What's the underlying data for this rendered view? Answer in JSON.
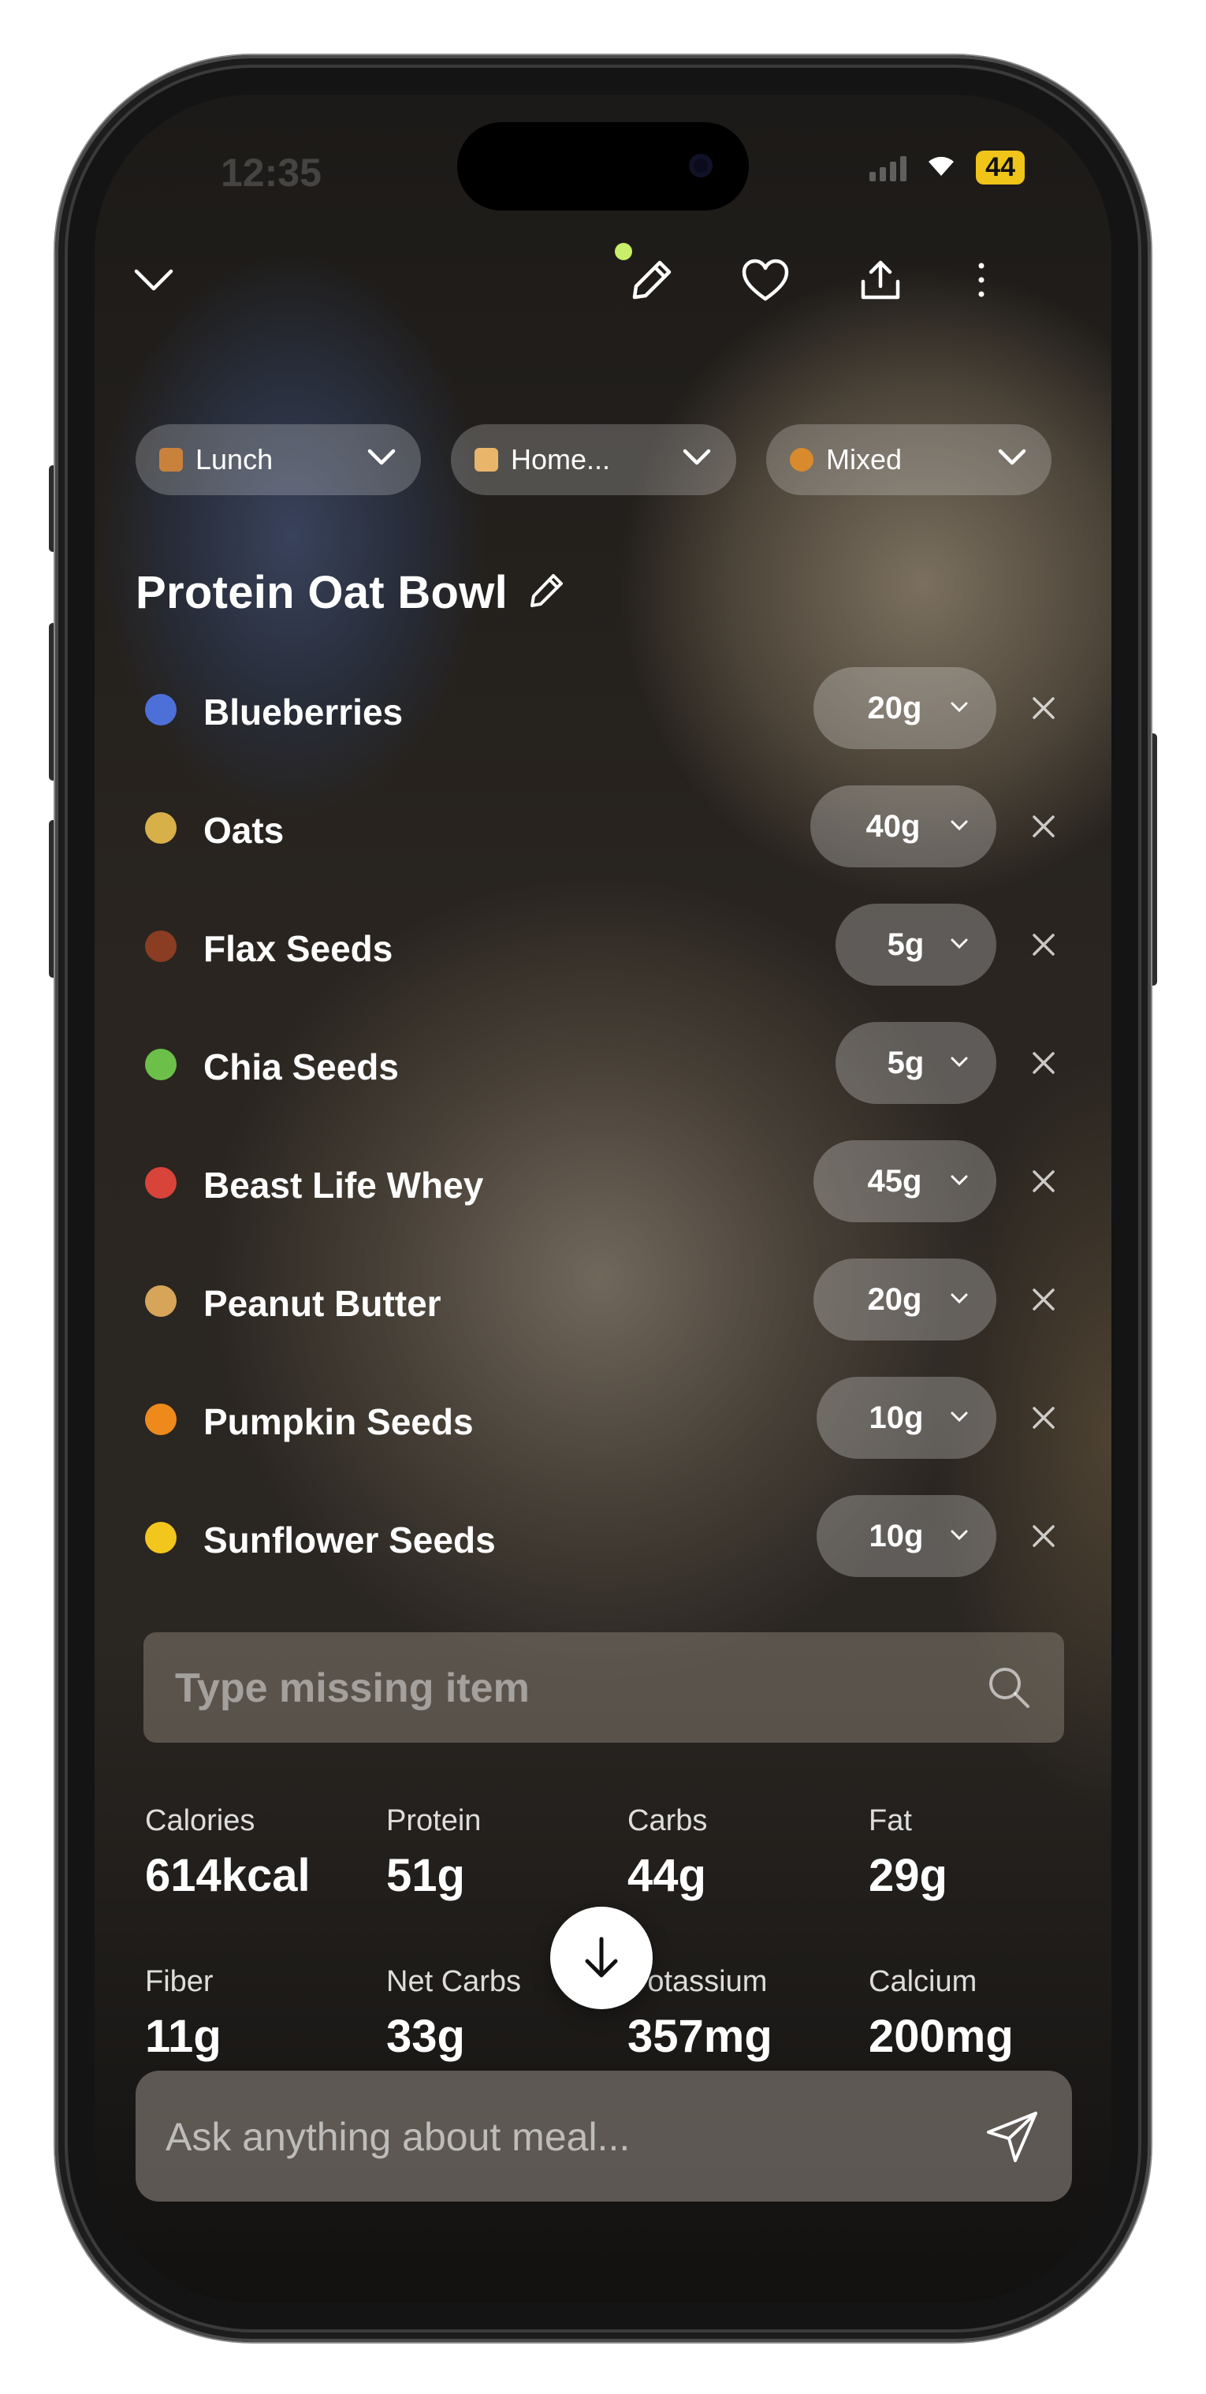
{
  "status_bar": {
    "time": "12:35",
    "battery": "44"
  },
  "toolbar": {
    "collapse_icon": "chevron-down-icon",
    "edit_icon": "pencil-icon",
    "favorite_icon": "heart-icon",
    "share_icon": "share-icon",
    "more_icon": "more-vertical-icon"
  },
  "chips": [
    {
      "label": "Lunch",
      "icon": "bento-emoji",
      "color": "#c9823c"
    },
    {
      "label": "Home...",
      "icon": "house-emoji",
      "color": "#e8b56b"
    },
    {
      "label": "Mixed",
      "icon": "mixed-emoji",
      "color": "#d88a2c"
    }
  ],
  "meal": {
    "title": "Protein Oat Bowl"
  },
  "ingredients": [
    {
      "name": "Blueberries",
      "qty": "20g",
      "icon": "blueberries-emoji",
      "color": "#4d6fd8"
    },
    {
      "name": "Oats",
      "qty": "40g",
      "icon": "grain-emoji",
      "color": "#d8b04a"
    },
    {
      "name": "Flax Seeds",
      "qty": "5g",
      "icon": "chestnut-emoji",
      "color": "#8a3d22"
    },
    {
      "name": "Chia Seeds",
      "qty": "5g",
      "icon": "seedling-emoji",
      "color": "#6cc04a"
    },
    {
      "name": "Beast Life Whey",
      "qty": "45g",
      "icon": "cup-emoji",
      "color": "#d8433a"
    },
    {
      "name": "Peanut Butter",
      "qty": "20g",
      "icon": "peanut-emoji",
      "color": "#d6a55a"
    },
    {
      "name": "Pumpkin Seeds",
      "qty": "10g",
      "icon": "pumpkin-emoji",
      "color": "#ee8a1c"
    },
    {
      "name": "Sunflower Seeds",
      "qty": "10g",
      "icon": "sunflower-emoji",
      "color": "#f3c61e"
    }
  ],
  "search": {
    "placeholder": "Type missing item"
  },
  "nutrition": [
    {
      "label": "Calories",
      "value": "614kcal"
    },
    {
      "label": "Protein",
      "value": "51g"
    },
    {
      "label": "Carbs",
      "value": "44g"
    },
    {
      "label": "Fat",
      "value": "29g"
    },
    {
      "label": "Fiber",
      "value": "11g"
    },
    {
      "label": "Net Carbs",
      "value": "33g"
    },
    {
      "label": "Potassium",
      "value": "357mg"
    },
    {
      "label": "Calcium",
      "value": "200mg"
    }
  ],
  "ask": {
    "placeholder": "Ask anything about meal..."
  }
}
